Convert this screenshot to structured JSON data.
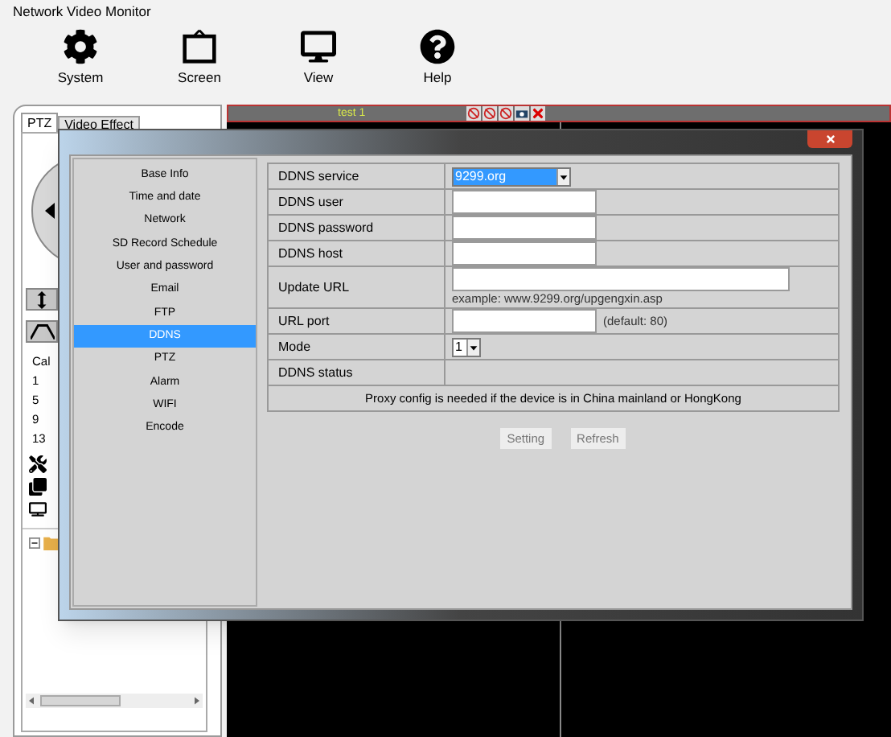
{
  "window": {
    "title": "Network Video Monitor"
  },
  "toolbar": [
    {
      "label": "System",
      "kind": "gear"
    },
    {
      "label": "Screen",
      "kind": "frame"
    },
    {
      "label": "View",
      "kind": "monitor"
    },
    {
      "label": "Help",
      "kind": "help"
    }
  ],
  "left_panel": {
    "tabs": [
      {
        "label": "PTZ",
        "selected": true
      },
      {
        "label": "Video Effect",
        "selected": false
      }
    ],
    "call_label": "Cal",
    "presets": [
      "1",
      "5",
      "9",
      "13"
    ]
  },
  "video": {
    "title": "test 1"
  },
  "dialog": {
    "menu": [
      {
        "label": "Base Info",
        "selected": false
      },
      {
        "label": "Time and date",
        "selected": false
      },
      {
        "label": "Network",
        "selected": false
      },
      {
        "label": "SD Record Schedule",
        "selected": false
      },
      {
        "label": "User and password",
        "selected": false
      },
      {
        "label": "Email",
        "selected": false
      },
      {
        "label": "FTP",
        "selected": false
      },
      {
        "label": "DDNS",
        "selected": true
      },
      {
        "label": "PTZ",
        "selected": false
      },
      {
        "label": "Alarm",
        "selected": false
      },
      {
        "label": "WIFI",
        "selected": false
      },
      {
        "label": "Encode",
        "selected": false
      }
    ],
    "rows": [
      {
        "label": "DDNS service",
        "kind": "select",
        "value": "9299.org",
        "wide": true
      },
      {
        "label": "DDNS user",
        "kind": "input"
      },
      {
        "label": "DDNS password",
        "kind": "input"
      },
      {
        "label": "DDNS host",
        "kind": "input"
      },
      {
        "label": "Update URL",
        "kind": "url",
        "hint": "example: www.9299.org/upgengxin.asp"
      },
      {
        "label": "URL port",
        "kind": "port",
        "note": "(default: 80)"
      },
      {
        "label": "Mode",
        "kind": "select",
        "value": "1",
        "wide": false
      },
      {
        "label": "DDNS status",
        "kind": "status"
      }
    ],
    "notice": "Proxy config is needed if the device is in China mainland or HongKong",
    "buttons": [
      "Setting",
      "Refresh"
    ]
  }
}
